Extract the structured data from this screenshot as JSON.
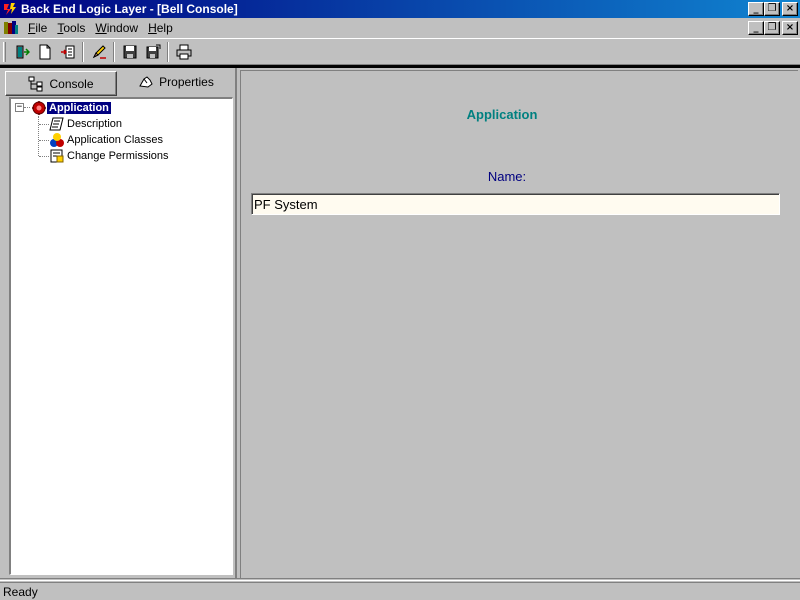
{
  "window": {
    "title": "Back End Logic Layer - [Bell Console]",
    "minimize_glyph": "_",
    "restore_glyph": "❐",
    "close_glyph": "×"
  },
  "menubar": {
    "items": [
      {
        "label": "File",
        "accel": "F",
        "rest": "ile"
      },
      {
        "label": "Tools",
        "accel": "T",
        "rest": "ools"
      },
      {
        "label": "Window",
        "accel": "W",
        "rest": "indow"
      },
      {
        "label": "Help",
        "accel": "H",
        "rest": "elp"
      }
    ]
  },
  "toolbar": {
    "buttons": [
      "connect-icon",
      "new-document-icon",
      "import-icon",
      "edit-pencil-icon",
      "save-icon",
      "save-as-icon",
      "print-icon"
    ]
  },
  "tabs": {
    "console_label": "Console",
    "properties_label": "Properties"
  },
  "tree": {
    "root": {
      "label": "Application",
      "expander": "−"
    },
    "children": [
      {
        "label": "Description"
      },
      {
        "label": "Application Classes"
      },
      {
        "label": "Change Permissions"
      }
    ]
  },
  "detail": {
    "heading": "Application",
    "name_label": "Name:",
    "name_value": "PF System"
  },
  "status": {
    "text": "Ready"
  },
  "colors": {
    "titlebar_start": "#000080",
    "titlebar_end": "#1084d0",
    "heading": "#008080",
    "label": "#000080",
    "face": "#c0c0c0"
  }
}
